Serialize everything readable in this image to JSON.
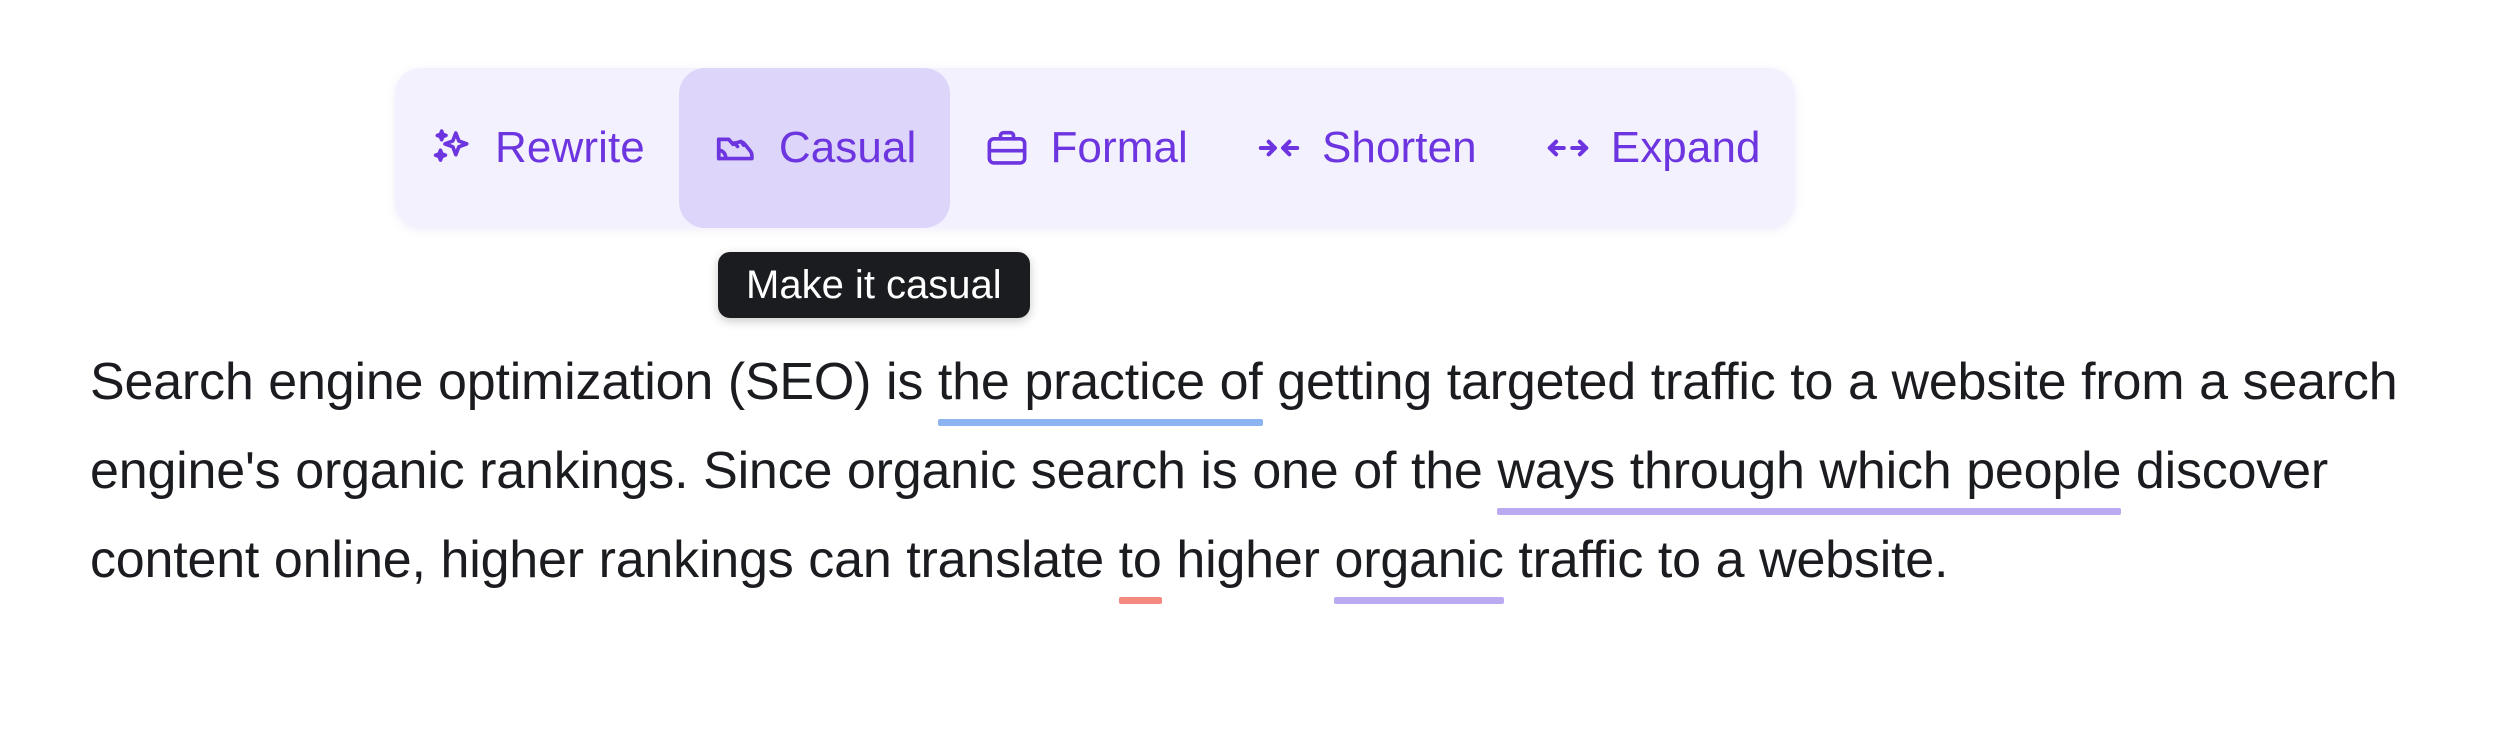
{
  "toolbar": {
    "buttons": [
      {
        "id": "rewrite",
        "label": "Rewrite",
        "icon": "sparkles-icon",
        "active": false
      },
      {
        "id": "casual",
        "label": "Casual",
        "icon": "sneaker-icon",
        "active": true
      },
      {
        "id": "formal",
        "label": "Formal",
        "icon": "briefcase-icon",
        "active": false
      },
      {
        "id": "shorten",
        "label": "Shorten",
        "icon": "arrows-in-icon",
        "active": false
      },
      {
        "id": "expand",
        "label": "Expand",
        "icon": "arrows-out-icon",
        "active": false
      }
    ]
  },
  "tooltip": {
    "text": "Make it casual"
  },
  "document": {
    "segments": [
      {
        "text": "Search engine optimization (SEO) is ",
        "mark": "none"
      },
      {
        "text": "the practice of",
        "mark": "blue"
      },
      {
        "text": " getting targeted traffic to a website from a ",
        "mark": "none"
      },
      {
        "text": "search engine's organic",
        "mark": "purple"
      },
      {
        "text": " rankings. Since organic search is one of the ",
        "mark": "none"
      },
      {
        "text": "ways through which people",
        "mark": "purple"
      },
      {
        "text": " discover content online, higher rankings can translate ",
        "mark": "none"
      },
      {
        "text": "to",
        "mark": "red"
      },
      {
        "text": " higher ",
        "mark": "none"
      },
      {
        "text": "organic",
        "mark": "purple"
      },
      {
        "text": " traffic to a website.",
        "mark": "none"
      }
    ],
    "full_text": "Search engine optimization (SEO) is the practice of getting targeted traffic to a website from a search engine's organic rankings. Since organic search is one of the ways through which people discover content online, higher rankings can translate to higher organic traffic to a website."
  },
  "colors": {
    "accent_purple": "#6d35e0",
    "toolbar_bg": "#f4f1fe",
    "active_btn_bg": "#ddd5fa",
    "tooltip_bg": "#1b1c20",
    "underline_blue": "#8cb4f0",
    "underline_purple": "#b9aaf2",
    "underline_red": "#f6897f",
    "text": "#1b1c20"
  }
}
